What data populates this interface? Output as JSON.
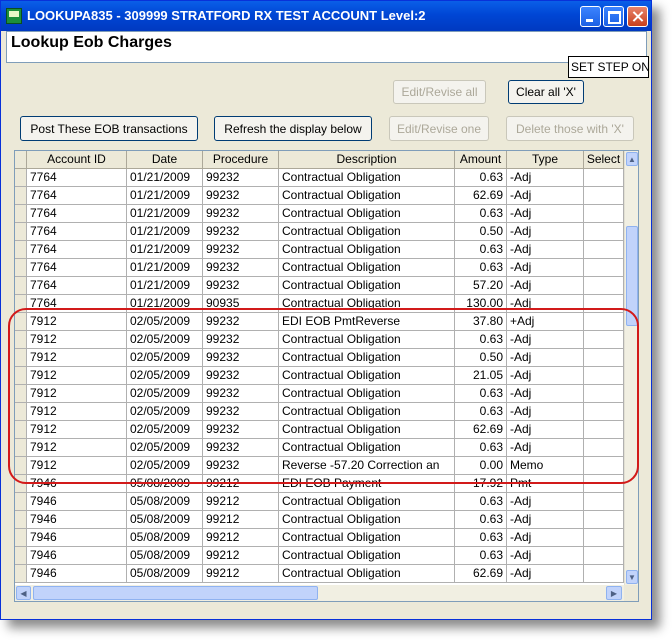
{
  "window": {
    "title": "LOOKUPA835  -  309999 STRATFORD RX TEST ACCOUNT Level:2",
    "icon": "app-icon"
  },
  "header": {
    "label": "Lookup Eob Charges"
  },
  "set_step": "SET STEP ON",
  "buttons": {
    "edit_revise_all": "Edit/Revise all",
    "clear_all_x": "Clear all 'X'",
    "post_eob": "Post These EOB transactions",
    "refresh": "Refresh the display below",
    "edit_revise_one": "Edit/Revise one",
    "delete_x": "Delete those with 'X'"
  },
  "table": {
    "columns": [
      "Account ID",
      "Date",
      "Procedure",
      "Description",
      "Amount",
      "Type",
      "Select"
    ],
    "rows": [
      [
        "7764",
        "01/21/2009",
        "99232",
        "Contractual Obligation",
        "0.63",
        "-Adj",
        ""
      ],
      [
        "7764",
        "01/21/2009",
        "99232",
        "Contractual Obligation",
        "62.69",
        "-Adj",
        ""
      ],
      [
        "7764",
        "01/21/2009",
        "99232",
        "Contractual Obligation",
        "0.63",
        "-Adj",
        ""
      ],
      [
        "7764",
        "01/21/2009",
        "99232",
        "Contractual Obligation",
        "0.50",
        "-Adj",
        ""
      ],
      [
        "7764",
        "01/21/2009",
        "99232",
        "Contractual Obligation",
        "0.63",
        "-Adj",
        ""
      ],
      [
        "7764",
        "01/21/2009",
        "99232",
        "Contractual Obligation",
        "0.63",
        "-Adj",
        ""
      ],
      [
        "7764",
        "01/21/2009",
        "99232",
        "Contractual Obligation",
        "57.20",
        "-Adj",
        ""
      ],
      [
        "7764",
        "01/21/2009",
        "90935",
        "Contractual Obligation",
        "130.00",
        "-Adj",
        ""
      ],
      [
        "7912",
        "02/05/2009",
        "99232",
        "EDI EOB PmtReverse",
        "37.80",
        "+Adj",
        ""
      ],
      [
        "7912",
        "02/05/2009",
        "99232",
        "Contractual Obligation",
        "0.63",
        "-Adj",
        ""
      ],
      [
        "7912",
        "02/05/2009",
        "99232",
        "Contractual Obligation",
        "0.50",
        "-Adj",
        ""
      ],
      [
        "7912",
        "02/05/2009",
        "99232",
        "Contractual Obligation",
        "21.05",
        "-Adj",
        ""
      ],
      [
        "7912",
        "02/05/2009",
        "99232",
        "Contractual Obligation",
        "0.63",
        "-Adj",
        ""
      ],
      [
        "7912",
        "02/05/2009",
        "99232",
        "Contractual Obligation",
        "0.63",
        "-Adj",
        ""
      ],
      [
        "7912",
        "02/05/2009",
        "99232",
        "Contractual Obligation",
        "62.69",
        "-Adj",
        ""
      ],
      [
        "7912",
        "02/05/2009",
        "99232",
        "Contractual Obligation",
        "0.63",
        "-Adj",
        ""
      ],
      [
        "7912",
        "02/05/2009",
        "99232",
        "Reverse -57.20 Correction an",
        "0.00",
        "Memo",
        ""
      ],
      [
        "7946",
        "05/08/2009",
        "99212",
        "EDI EOB Payment",
        "17.92",
        "Pmt",
        ""
      ],
      [
        "7946",
        "05/08/2009",
        "99212",
        "Contractual Obligation",
        "0.63",
        "-Adj",
        ""
      ],
      [
        "7946",
        "05/08/2009",
        "99212",
        "Contractual Obligation",
        "0.63",
        "-Adj",
        ""
      ],
      [
        "7946",
        "05/08/2009",
        "99212",
        "Contractual Obligation",
        "0.63",
        "-Adj",
        ""
      ],
      [
        "7946",
        "05/08/2009",
        "99212",
        "Contractual Obligation",
        "0.63",
        "-Adj",
        ""
      ],
      [
        "7946",
        "05/08/2009",
        "99212",
        "Contractual Obligation",
        "62.69",
        "-Adj",
        ""
      ]
    ]
  },
  "highlight_color": "#d21a1a"
}
